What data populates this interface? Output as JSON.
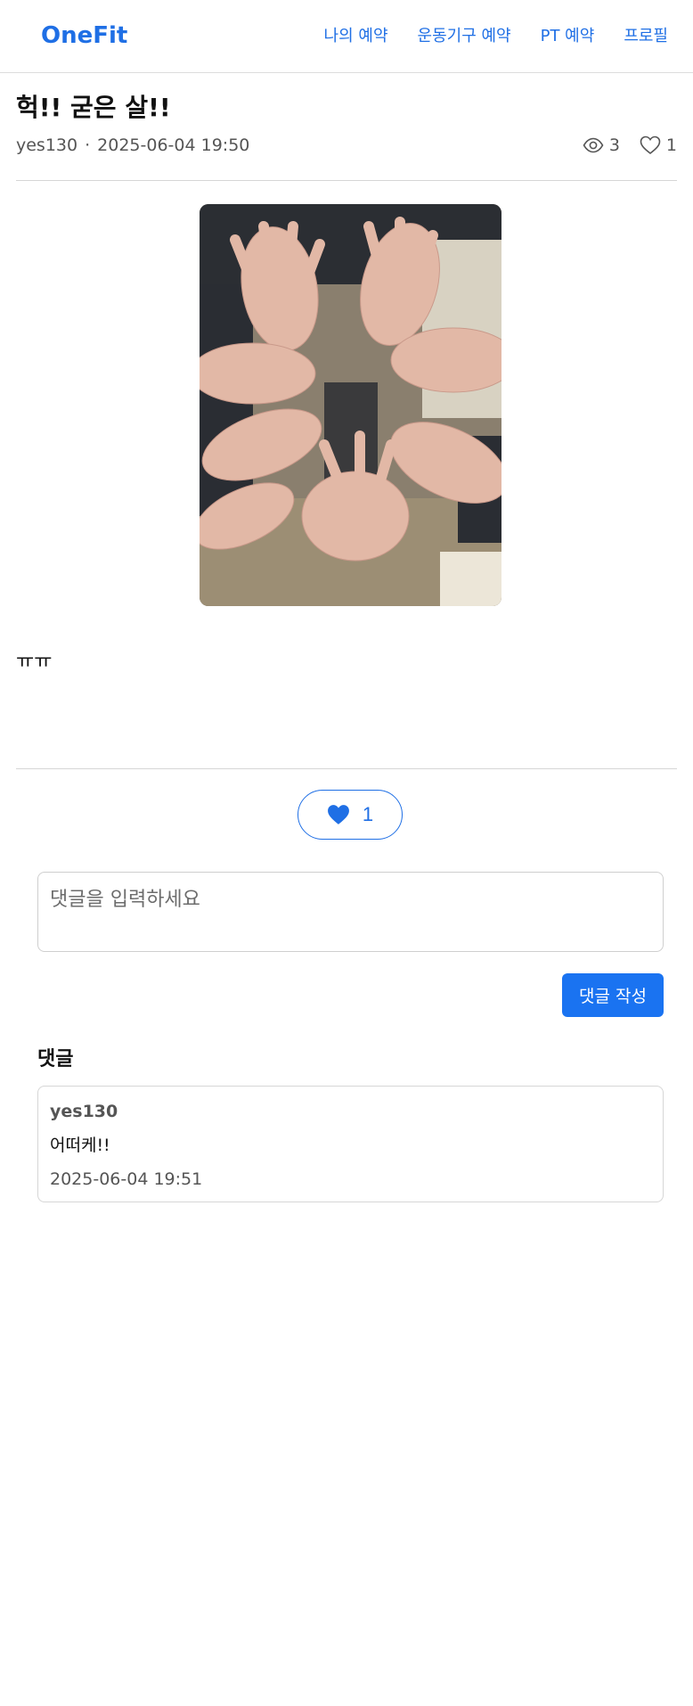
{
  "nav": {
    "brand": "OneFit",
    "links": [
      "나의 예약",
      "운동기구 예약",
      "PT 예약",
      "프로필"
    ]
  },
  "post": {
    "title": "헉!! 굳은 살!!",
    "author": "yes130",
    "date": "2025-06-04 19:50",
    "views": "3",
    "likes": "1",
    "body": "ㅠㅠ",
    "image_icon": "photo-of-hands"
  },
  "like_button": {
    "count": "1",
    "icon": "heart-filled-icon"
  },
  "comment_form": {
    "placeholder": "댓글을 입력하세요",
    "submit_label": "댓글 작성"
  },
  "comments": {
    "heading": "댓글",
    "items": [
      {
        "author": "yes130",
        "text": "어떠케!!",
        "date": "2025-06-04 19:51"
      }
    ]
  },
  "colors": {
    "accent": "#1f6fe5",
    "button": "#1a73f1"
  }
}
